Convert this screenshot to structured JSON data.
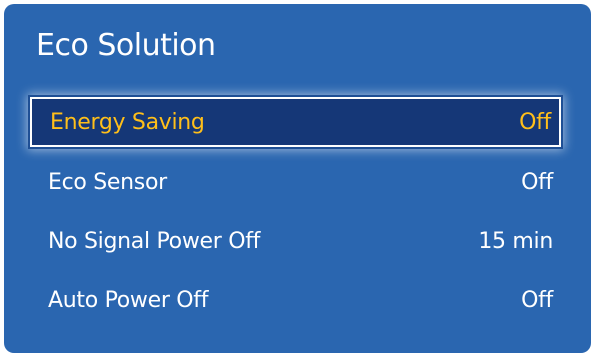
{
  "panel": {
    "title": "Eco Solution",
    "items": [
      {
        "label": "Energy Saving",
        "value": "Off",
        "selected": true
      },
      {
        "label": "Eco Sensor",
        "value": "Off",
        "selected": false
      },
      {
        "label": "No Signal Power Off",
        "value": "15 min",
        "selected": false
      },
      {
        "label": "Auto Power Off",
        "value": "Off",
        "selected": false
      }
    ]
  },
  "colors": {
    "panel_background": "#2a66b0",
    "selected_background": "#153777",
    "selected_text": "#ffbf1a",
    "text": "#ffffff"
  }
}
